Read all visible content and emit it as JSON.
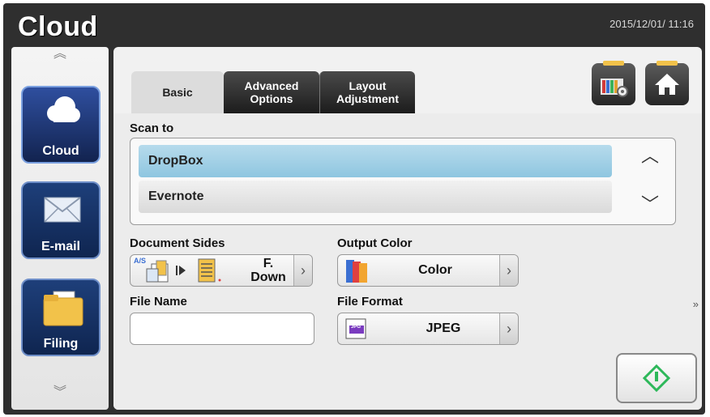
{
  "app": {
    "title": "Cloud",
    "datetime": "2015/12/01/ 11:16"
  },
  "sidebar": {
    "items": [
      {
        "label": "Cloud"
      },
      {
        "label": "E-mail"
      },
      {
        "label": "Filing"
      }
    ]
  },
  "tabs": {
    "basic": "Basic",
    "advanced": [
      "Advanced",
      "Options"
    ],
    "layout": [
      "Layout",
      "Adjustment"
    ]
  },
  "scan_to": {
    "label": "Scan to",
    "items": [
      "DropBox",
      "Evernote"
    ],
    "selected": "DropBox"
  },
  "document_sides": {
    "label": "Document Sides",
    "value": [
      "F.",
      "Down"
    ],
    "badge": "A/S"
  },
  "output_color": {
    "label": "Output Color",
    "value": "Color"
  },
  "file_name": {
    "label": "File Name",
    "value": ""
  },
  "file_format": {
    "label": "File Format",
    "value": "JPEG",
    "icon_text": "JPG"
  },
  "colors": {
    "selected": "#9fd0e6",
    "accent_green": "#2db85a",
    "folder": "#f2c24a"
  }
}
